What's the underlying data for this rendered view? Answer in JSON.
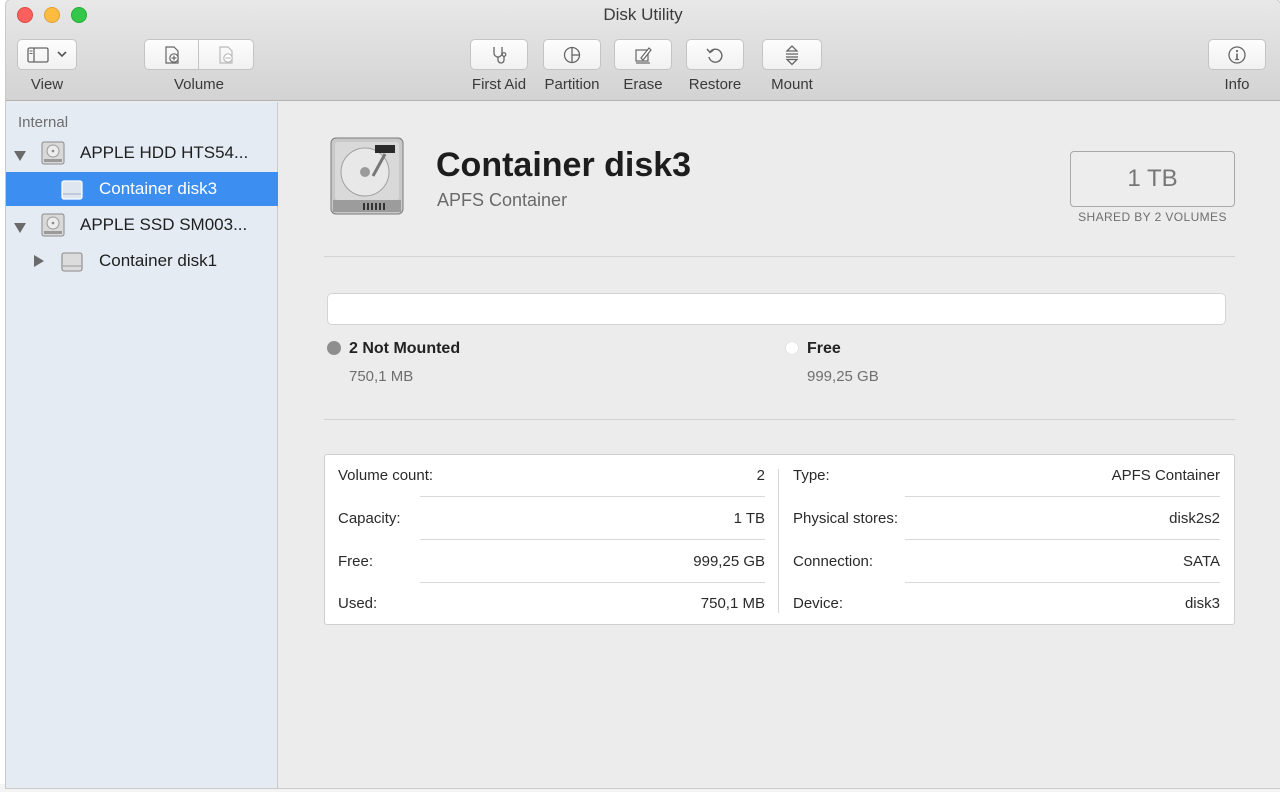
{
  "window": {
    "title": "Disk Utility"
  },
  "toolbar": {
    "view_label": "View",
    "volume_label": "Volume",
    "first_aid_label": "First Aid",
    "partition_label": "Partition",
    "erase_label": "Erase",
    "restore_label": "Restore",
    "mount_label": "Mount",
    "info_label": "Info"
  },
  "sidebar": {
    "section": "Internal",
    "items": [
      {
        "label": "APPLE HDD HTS54..."
      },
      {
        "label": "Container disk3"
      },
      {
        "label": "APPLE SSD SM003..."
      },
      {
        "label": "Container disk1"
      }
    ]
  },
  "detail": {
    "name": "Container disk3",
    "kind": "APFS Container",
    "size": "1 TB",
    "size_caption": "SHARED BY 2 VOLUMES",
    "legend": [
      {
        "title": "2 Not Mounted",
        "value": "750,1 MB",
        "color": "#8e8e8e"
      },
      {
        "title": "Free",
        "value": "999,25 GB",
        "color": "#ffffff"
      }
    ],
    "info_left": [
      {
        "key": "Volume count:",
        "value": "2"
      },
      {
        "key": "Capacity:",
        "value": "1 TB"
      },
      {
        "key": "Free:",
        "value": "999,25 GB"
      },
      {
        "key": "Used:",
        "value": "750,1 MB"
      }
    ],
    "info_right": [
      {
        "key": "Type:",
        "value": "APFS Container"
      },
      {
        "key": "Physical stores:",
        "value": "disk2s2"
      },
      {
        "key": "Connection:",
        "value": "SATA"
      },
      {
        "key": "Device:",
        "value": "disk3"
      }
    ]
  },
  "colors": {
    "selection": "#3d8ef1",
    "sidebar_bg": "#e4ebf3",
    "window_bg": "#ececec"
  }
}
